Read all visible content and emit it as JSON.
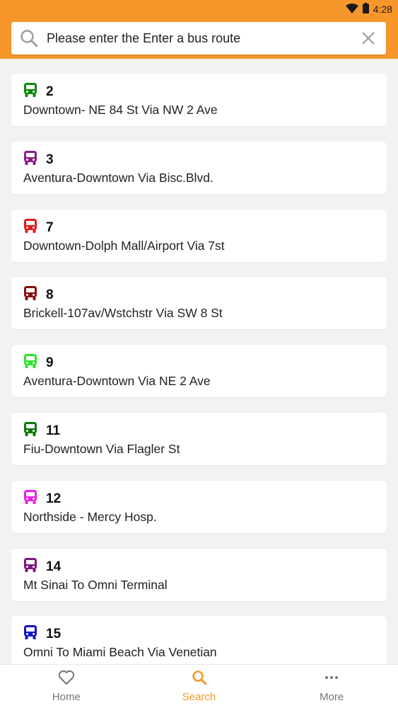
{
  "status_bar": {
    "time": "4:28"
  },
  "search": {
    "placeholder": "Please enter the Enter a bus route"
  },
  "routes": [
    {
      "number": "2",
      "name": "Downtown- NE 84 St Via NW 2 Ave",
      "color": "#0b8a0b"
    },
    {
      "number": "3",
      "name": "Aventura-Downtown Via Bisc.Blvd.",
      "color": "#8b1b8b"
    },
    {
      "number": "7",
      "name": "Downtown-Dolph Mall/Airport Via 7st",
      "color": "#e31b1b"
    },
    {
      "number": "8",
      "name": "Brickell-107av/Wstchstr Via SW 8 St",
      "color": "#8b0d0d"
    },
    {
      "number": "9",
      "name": "Aventura-Downtown Via NE 2 Ave",
      "color": "#2ce52c"
    },
    {
      "number": "11",
      "name": "Fiu-Downtown Via Flagler St",
      "color": "#0b7a0b"
    },
    {
      "number": "12",
      "name": "Northside - Mercy Hosp.",
      "color": "#ee1ee8"
    },
    {
      "number": "14",
      "name": "Mt Sinai To Omni Terminal",
      "color": "#7a1a7a"
    },
    {
      "number": "15",
      "name": "Omni To Miami Beach Via Venetian",
      "color": "#1414c8"
    }
  ],
  "bottom_nav": {
    "home": "Home",
    "search": "Search",
    "more": "More"
  },
  "colors": {
    "accent": "#f7962a"
  }
}
